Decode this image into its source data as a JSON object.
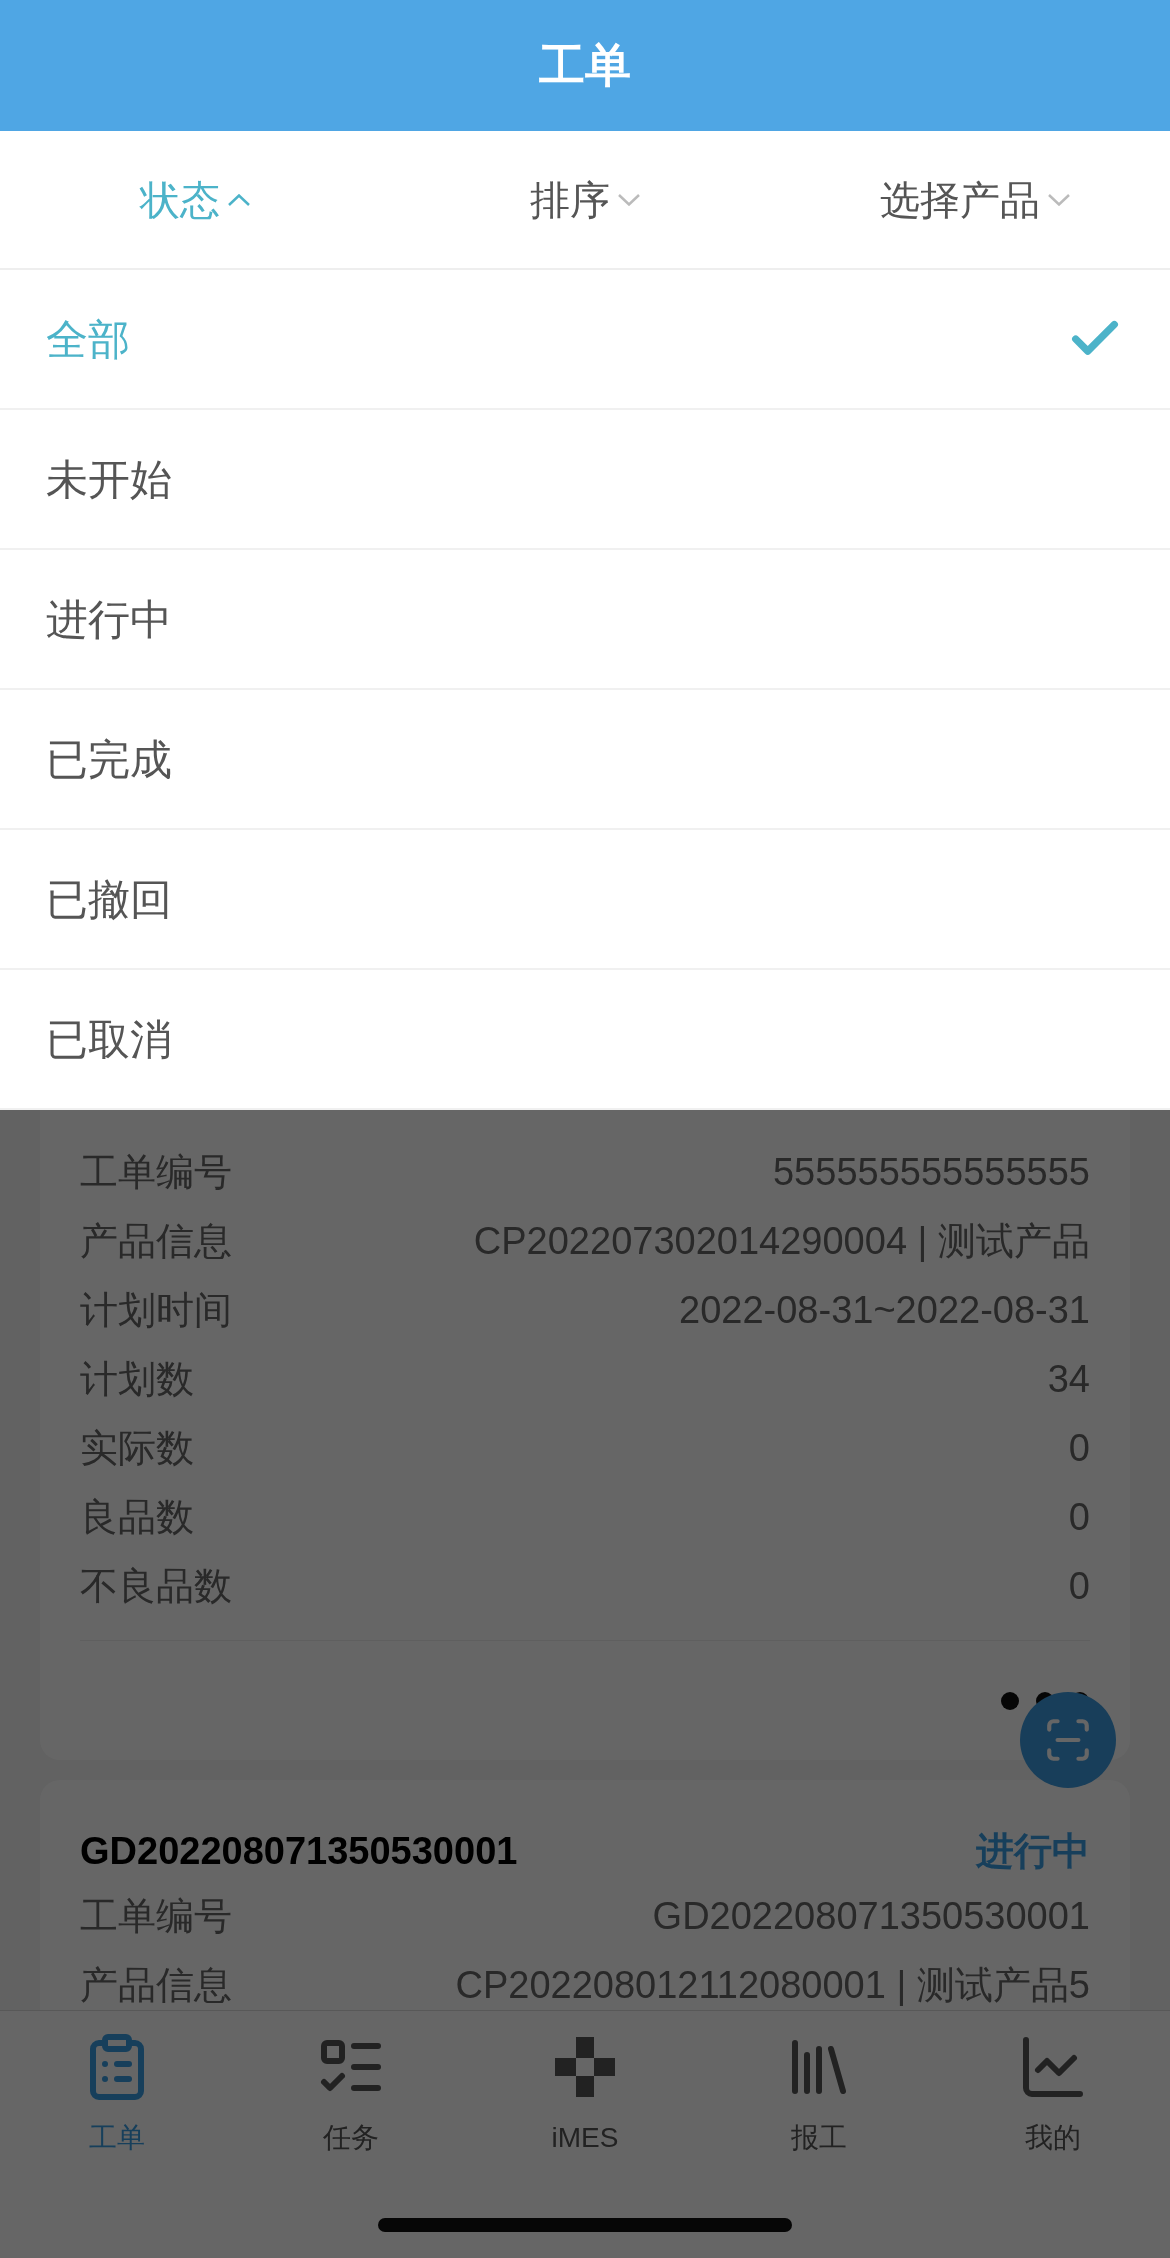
{
  "header": {
    "title": "工单"
  },
  "filters": [
    {
      "label": "状态",
      "selected": true
    },
    {
      "label": "排序",
      "selected": false
    },
    {
      "label": "选择产品",
      "selected": false
    }
  ],
  "status_options": [
    {
      "label": "全部",
      "selected": true
    },
    {
      "label": "未开始",
      "selected": false
    },
    {
      "label": "进行中",
      "selected": false
    },
    {
      "label": "已完成",
      "selected": false
    },
    {
      "label": "已撤回",
      "selected": false
    },
    {
      "label": "已取消",
      "selected": false
    }
  ],
  "cards": [
    {
      "rows": [
        {
          "label": "工单编号",
          "value": "555555555555555"
        },
        {
          "label": "产品信息",
          "value": "CP202207302014290004 | 测试产品"
        },
        {
          "label": "计划时间",
          "value": "2022-08-31~2022-08-31"
        },
        {
          "label": "计划数",
          "value": "34"
        },
        {
          "label": "实际数",
          "value": "0"
        },
        {
          "label": "良品数",
          "value": "0"
        },
        {
          "label": "不良品数",
          "value": "0"
        }
      ]
    },
    {
      "title": "GD202208071350530001",
      "status": "进行中",
      "rows": [
        {
          "label": "工单编号",
          "value": "GD202208071350530001"
        },
        {
          "label": "产品信息",
          "value": "CP202208012112080001 | 测试产品5"
        }
      ]
    }
  ],
  "tab_bar": [
    {
      "label": "工单",
      "kind": "clipboard",
      "selected": true
    },
    {
      "label": "任务",
      "kind": "checklist",
      "selected": false
    },
    {
      "label": "iMES",
      "kind": "cross",
      "selected": false
    },
    {
      "label": "报工",
      "kind": "books",
      "selected": false
    },
    {
      "label": "我的",
      "kind": "chart",
      "selected": false
    }
  ]
}
